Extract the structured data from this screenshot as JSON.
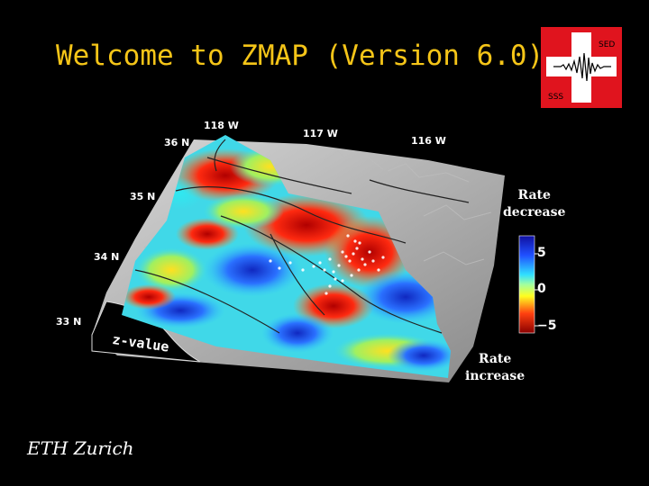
{
  "title": "Welcome to ZMAP (Version 6.0)",
  "logo": {
    "top_text": "SED",
    "bottom_text": "SSS",
    "bg_color": "#e0141e"
  },
  "map": {
    "longitudes": [
      "118 W",
      "117 W",
      "116 W"
    ],
    "latitudes": [
      "36 N",
      "35 N",
      "34 N",
      "33 N"
    ],
    "zvalue_label": "z-value"
  },
  "colorbar": {
    "top_label": "Rate\ndecrease",
    "bottom_label": "Rate\nincrease",
    "ticks": [
      "5",
      "0",
      "−5"
    ]
  },
  "footer": "ETH Zurich",
  "colors": {
    "title": "#f5c518",
    "background": "#000000"
  }
}
